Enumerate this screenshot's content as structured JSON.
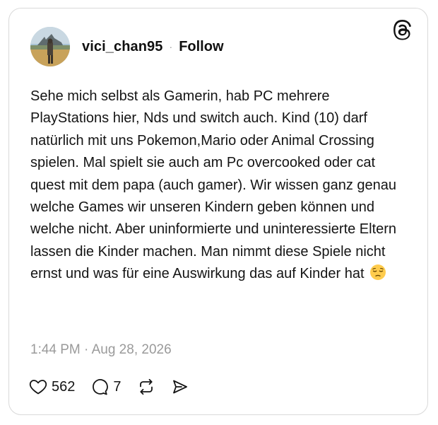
{
  "post": {
    "username": "vici_chan95",
    "separator": "·",
    "follow_label": "Follow",
    "text": "Sehe mich selbst als Gamerin, hab PC mehrere PlayStations hier, Nds und switch auch. Kind (10) darf natürlich mit uns Pokemon,Mario oder Animal Crossing spielen. Mal spielt sie auch am Pc overcooked oder cat quest mit dem papa (auch gamer). Wir wissen ganz genau welche Games wir unseren Kindern geben können und welche nicht. Aber uninformierte und uninteressierte Eltern lassen die Kinder machen. Man nimmt diese Spiele nicht ernst und was für eine Auswirkung das auf Kinder hat",
    "emoji": "pensive-face",
    "timestamp": "1:44 PM · Aug 28, 2026"
  },
  "actions": {
    "likes": "562",
    "replies": "7"
  },
  "icons": {
    "brand": "threads-logo-icon",
    "like": "heart-icon",
    "reply": "comment-icon",
    "repost": "repost-icon",
    "share": "share-icon"
  },
  "colors": {
    "text": "#141414",
    "muted": "#9a9a9a",
    "border": "#d9d9d9"
  }
}
